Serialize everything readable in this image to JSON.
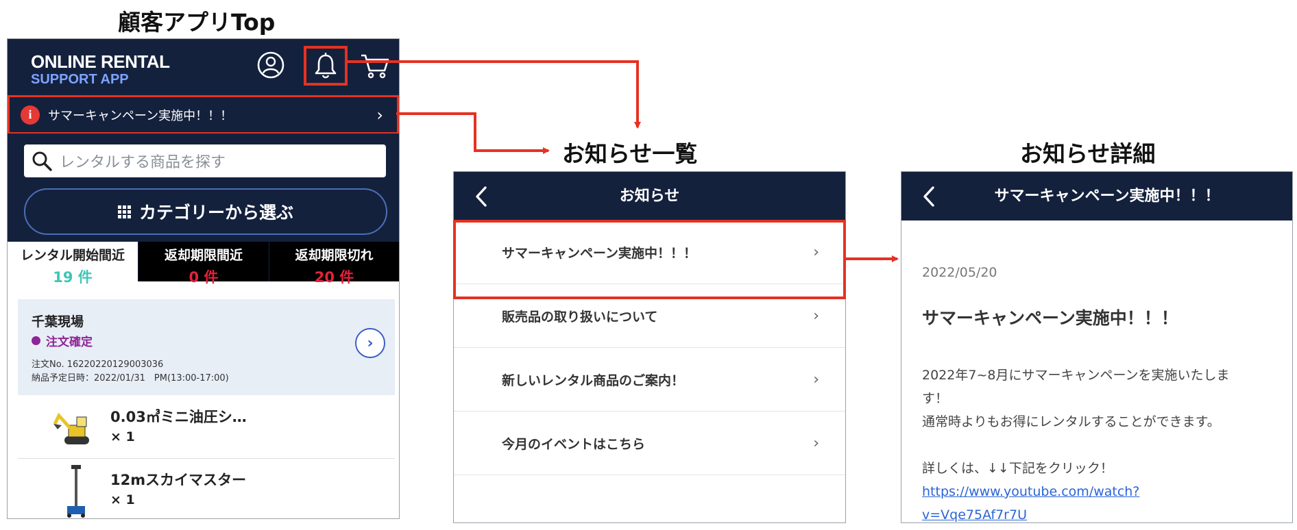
{
  "headings": {
    "top": "顧客アプリTop",
    "list": "お知らせ一覧",
    "detail": "お知らせ詳細"
  },
  "app": {
    "logo_line1": "ONLINE RENTAL",
    "logo_line2": "SUPPORT APP",
    "banner_text": "サマーキャンペーン実施中！！！",
    "search_placeholder": "レンタルする商品を探す",
    "category_button": "カテゴリーから選ぶ",
    "tabs": [
      {
        "label": "レンタル開始間近",
        "count": "19 件"
      },
      {
        "label": "返却期限間近",
        "count": "0 件"
      },
      {
        "label": "返却期限切れ",
        "count": "20 件"
      }
    ],
    "order": {
      "site": "千葉現場",
      "status": "注文確定",
      "order_no": "注文No. 16220220129003036",
      "delivery": "納品予定日時：2022/01/31　PM(13:00-17:00)"
    },
    "items": [
      {
        "name": "0.03㎥ミニ油圧シ…",
        "qty": "× 1"
      },
      {
        "name": "12mスカイマスター",
        "qty": "× 1"
      }
    ]
  },
  "list_screen": {
    "title": "お知らせ",
    "items": [
      "サマーキャンペーン実施中！！！",
      "販売品の取り扱いについて",
      "新しいレンタル商品のご案内！",
      "今月のイベントはこちら"
    ]
  },
  "detail_screen": {
    "title": "サマーキャンペーン実施中！！！",
    "date": "2022/05/20",
    "heading": "サマーキャンペーン実施中！！！",
    "body_line1": "2022年7~8月にサマーキャンペーンを実施いたしま",
    "body_line2": "す！",
    "body_line3": "通常時よりもお得にレンタルすることができます。",
    "body_line4": "詳しくは、↓↓下記をクリック！",
    "link_line1": "https://www.youtube.com/watch?",
    "link_line2": "v=Vqe75Af7r7U"
  },
  "colors": {
    "navy": "#14213d",
    "highlight_red": "#e53222",
    "accent_teal": "#3ec6b4",
    "alert_red": "#e8203a",
    "status_purple": "#8e2496"
  }
}
